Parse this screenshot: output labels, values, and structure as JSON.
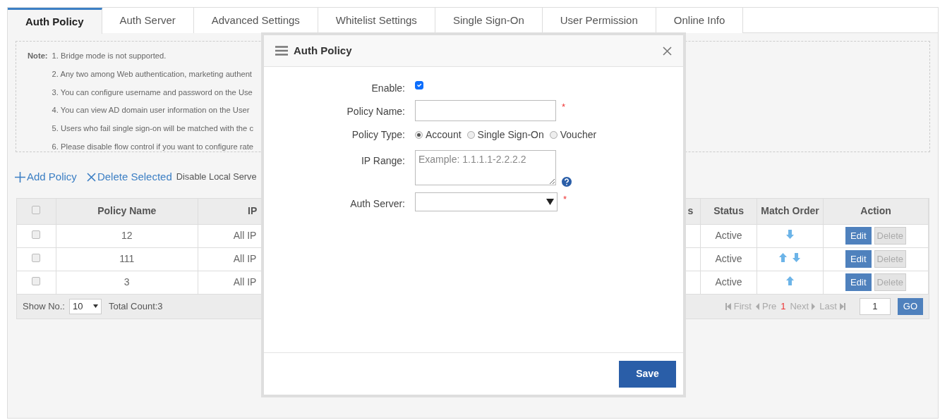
{
  "tabs": [
    {
      "label": "Auth Policy",
      "selected": true
    },
    {
      "label": "Auth Server",
      "selected": false
    },
    {
      "label": "Advanced Settings",
      "selected": false
    },
    {
      "label": "Whitelist Settings",
      "selected": false
    },
    {
      "label": "Single Sign-On",
      "selected": false
    },
    {
      "label": "User Permission",
      "selected": false
    },
    {
      "label": "Online Info",
      "selected": false
    }
  ],
  "note": {
    "label": "Note:",
    "lines": [
      "1. Bridge mode is not supported.",
      "2. Any two among Web authentication, marketing authent",
      "3. You can configure username and password on the Use",
      "4. You can view AD domain user information on the User",
      "5. Users who fail single sign-on will be matched with the c",
      "6. Please disable flow control if you want to configure rate"
    ]
  },
  "toolbar": [
    {
      "kind": "add",
      "label": "Add Policy"
    },
    {
      "kind": "delete",
      "label": "Delete Selected"
    },
    {
      "kind": "text",
      "label": "Disable Local Serve"
    }
  ],
  "table": {
    "header_checked": false,
    "columns": [
      "Policy Name",
      "IP",
      "s",
      "Status",
      "Match Order",
      "Action"
    ],
    "rows": [
      {
        "checked": false,
        "name": "12",
        "ip": "All IP",
        "status": "Active",
        "move_up": false,
        "move_down": true,
        "actions": [
          "Edit",
          "Delete"
        ]
      },
      {
        "checked": false,
        "name": "111",
        "ip": "All IP",
        "status": "Active",
        "move_up": true,
        "move_down": true,
        "actions": [
          "Edit",
          "Delete"
        ]
      },
      {
        "checked": false,
        "name": "3",
        "ip": "All IP",
        "status": "Active",
        "move_up": true,
        "move_down": false,
        "actions": [
          "Edit",
          "Delete"
        ]
      }
    ],
    "footer": {
      "show_label": "Show No.:",
      "show_value": "10",
      "total": "Total Count:3",
      "pager": [
        {
          "label": "First",
          "disabled": true
        },
        {
          "label": "Pre",
          "disabled": true
        },
        {
          "label": "1",
          "current": true
        },
        {
          "label": "Next",
          "disabled": true
        },
        {
          "label": "Last",
          "disabled": true
        }
      ],
      "page_value": "1",
      "go": "GO"
    }
  },
  "modal": {
    "title": "Auth Policy",
    "fields": [
      {
        "kind": "checkbox",
        "label": "Enable:",
        "checked": true
      },
      {
        "kind": "text",
        "label": "Policy Name:",
        "required": true,
        "required_mark": "*"
      },
      {
        "kind": "radio",
        "label": "Policy Type:",
        "options": [
          {
            "label": "Account",
            "selected": true
          },
          {
            "label": "Single Sign-On",
            "selected": false
          },
          {
            "label": "Voucher",
            "selected": false
          }
        ]
      },
      {
        "kind": "textarea",
        "label": "IP Range:",
        "placeholder": "Example: 1.1.1.1-2.2.2.2",
        "help": true
      },
      {
        "kind": "select",
        "label": "Auth Server:",
        "required": true,
        "required_mark": "*"
      }
    ],
    "save": "Save"
  }
}
